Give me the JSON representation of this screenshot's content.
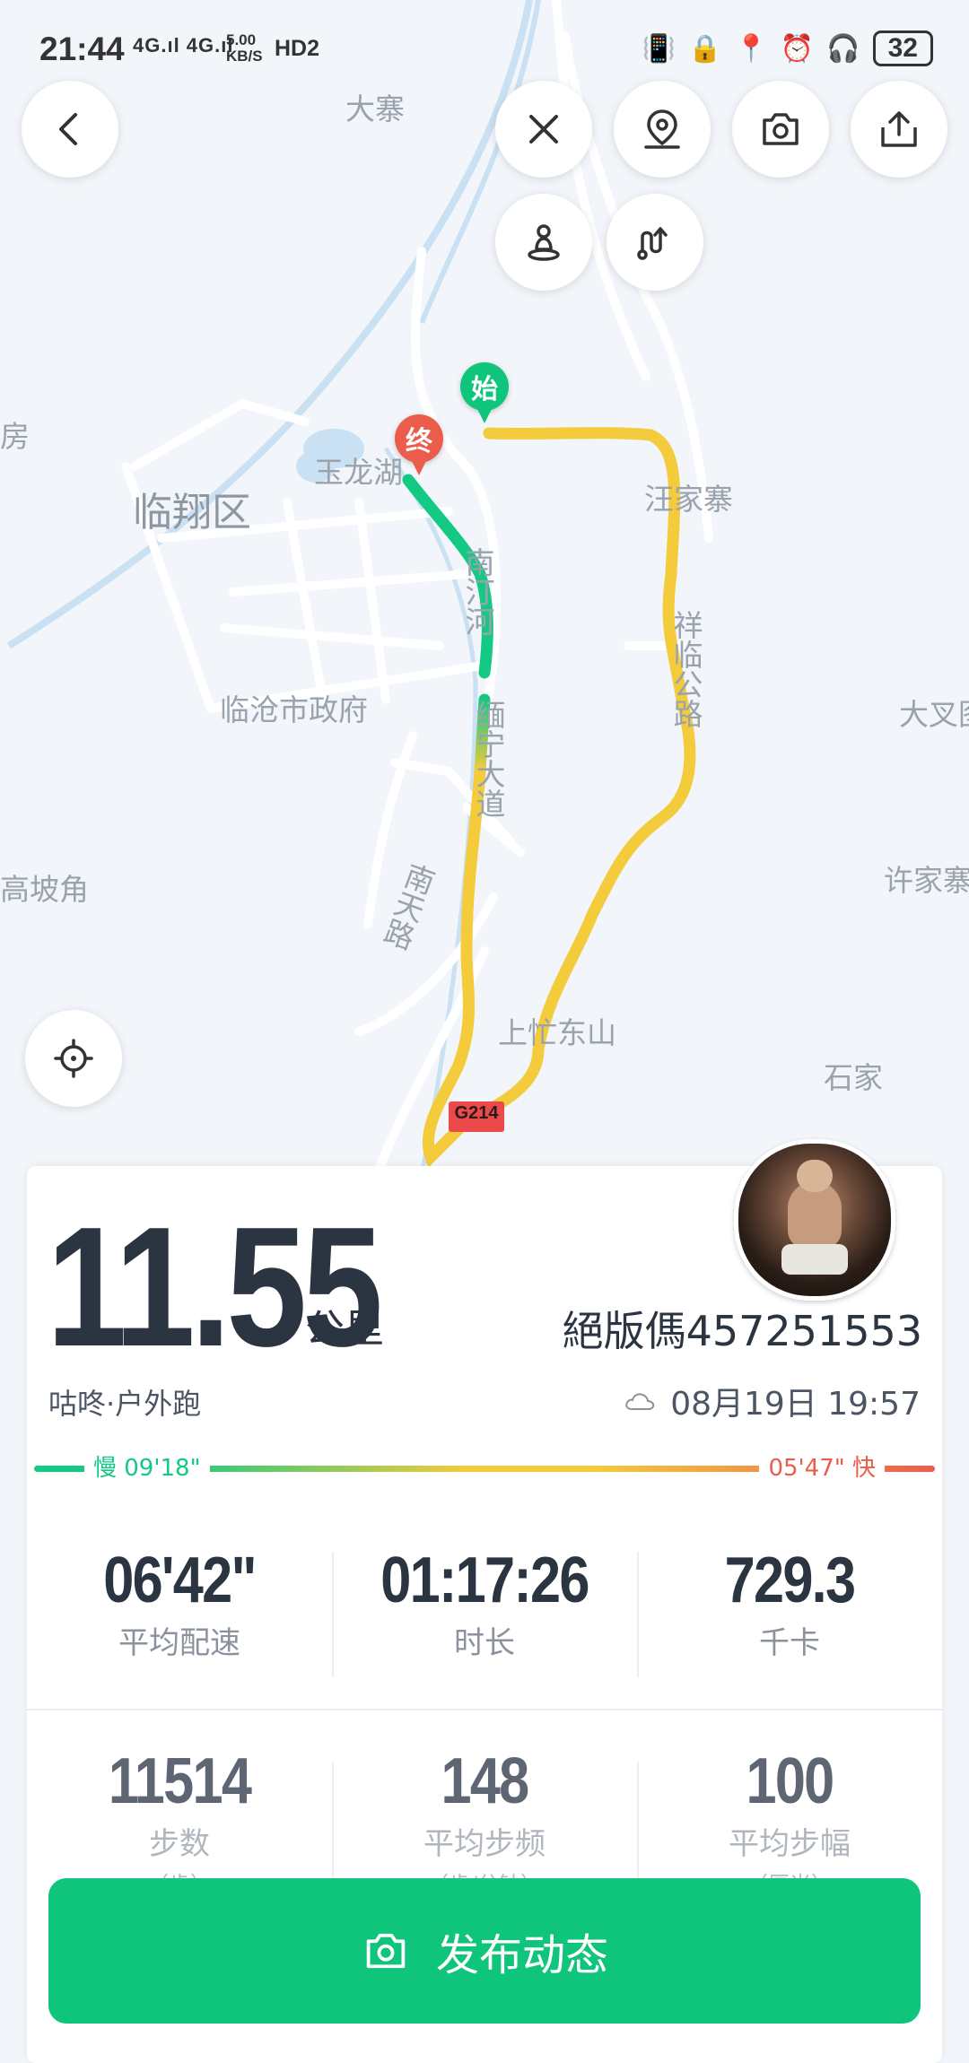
{
  "status_bar": {
    "time": "21:44",
    "network": "4G.ıl 4G.ıl",
    "speed_top": "5.00",
    "speed_bottom": "KB/S",
    "hd": "HD2",
    "battery": "32"
  },
  "map": {
    "labels": {
      "dazhai": "大寨",
      "fang": "房",
      "linxiang": "临翔区",
      "yulonghu": "玉龙湖",
      "wangjiazhai": "汪家寨",
      "nanting_river": "南汀河",
      "nanting_road": "南天路",
      "government": "临沧市政府",
      "avenue": "缅宁大道",
      "gaopojiao": "高坡角",
      "daxing": "大叉图",
      "xujiazhai": "许家寨",
      "dongshan": "上忙东山",
      "shijia": "石家",
      "highway": "祥临公路",
      "road_sign": "G214"
    },
    "start_pin": "始",
    "end_pin": "终",
    "route_colors": {
      "slow": "#13c983",
      "medium": "#f3cb3b",
      "fast": "#ec5c4a"
    }
  },
  "toolbar": {
    "back_icon": "chevron-left-icon",
    "close_icon": "close-icon",
    "location_pin_icon": "location-pin-icon",
    "camera_icon": "camera-icon",
    "share_icon": "share-icon",
    "person_icon": "person-on-map-icon",
    "route_icon": "route-icon",
    "locate_icon": "crosshair-icon"
  },
  "summary": {
    "distance": "11.55",
    "distance_unit": "公里",
    "username": "絕版傌457251553",
    "activity": "咕咚·户外跑",
    "weather_icon": "cloud-icon",
    "datetime": "08月19日 19:57",
    "slow_label": "慢 09'18\"",
    "fast_label": "05'47\" 快"
  },
  "stats_row1": [
    {
      "value": "06'42\"",
      "label": "平均配速"
    },
    {
      "value": "01:17:26",
      "label": "时长"
    },
    {
      "value": "729.3",
      "label": "千卡"
    }
  ],
  "stats_row2": [
    {
      "value": "11514",
      "label": "步数",
      "unit": "（步）"
    },
    {
      "value": "148",
      "label": "平均步频",
      "unit": "（步/分钟）"
    },
    {
      "value": "100",
      "label": "平均步幅",
      "unit": "（厘米）"
    }
  ],
  "publish": {
    "label": "发布动态"
  }
}
